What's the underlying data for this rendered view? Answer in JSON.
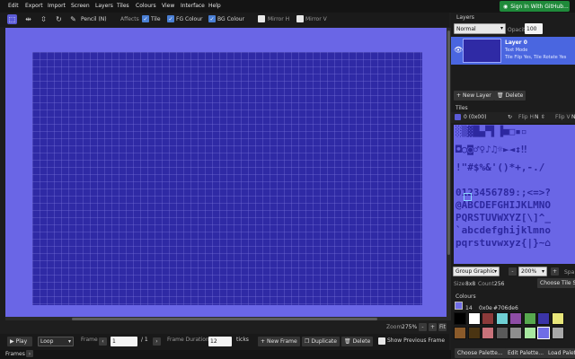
{
  "menubar": {
    "items": [
      "Edit",
      "Export",
      "Import",
      "Screen",
      "Layers",
      "Tiles",
      "Colours",
      "View",
      "Interface",
      "Help"
    ],
    "github_label": "Sign In With GitHub..."
  },
  "toolbar": {
    "tool_label": "Pencil (N)",
    "affects_label": "Affects",
    "tile_label": "Tile",
    "fg_label": "FG Colour",
    "bg_label": "BG Colour",
    "mirror_h_label": "Mirror H",
    "mirror_v_label": "Mirror V"
  },
  "canvas": {
    "zoom_label": "Zoom",
    "zoom_value": "275%",
    "zoom_minus": "-",
    "zoom_plus": "+",
    "fit_label": "Fit"
  },
  "animation": {
    "play_label": "Play",
    "loop_value": "Loop",
    "frame_label": "Frame",
    "frame_value": "1",
    "frame_total": "/ 1",
    "duration_label": "Frame Duration",
    "duration_value": "12",
    "ticks_label": "ticks",
    "new_frame_label": "New Frame",
    "duplicate_label": "Duplicate",
    "delete_label": "Delete",
    "show_prev_label": "Show Previous Frame",
    "frames_tab_label": "Frames"
  },
  "layers": {
    "title": "Layers",
    "blend_value": "Normal",
    "opacity_label": "Opacity",
    "opacity_value": "100",
    "layer_name": "Layer 0",
    "layer_mode": "Text Mode",
    "layer_flags": "Tile Flip Yes, Tile Rotate Yes",
    "new_layer_label": "New Layer",
    "delete_label": "Delete"
  },
  "tiles": {
    "title": "Tiles",
    "selected": "0 (0x00)",
    "flip_h_label": "Flip H",
    "flip_h_value": "N",
    "flip_v_label": "Flip V",
    "flip_v_value": "N",
    "group_value": "Group Graphic",
    "zoom_value": "200%",
    "spacing_label": "Spa",
    "size_label": "Size",
    "size_value": "8x8",
    "count_label": "Count",
    "count_value": "256",
    "choose_label": "Choose Tile Se",
    "glyph_rows": [
      "░▒▓█▄▀▌▐■□▪▫",
      "◘○◙♂♀♪♫☼►◄↕‼",
      "!\"#$%&'()*+,-./",
      "0123456789:;<=>?",
      "@ABCDEFGHIJKLMNO",
      "PQRSTUVWXYZ[\\]^_",
      "`abcdefghijklmno",
      "pqrstuvwxyz{|}~⌂"
    ]
  },
  "colours": {
    "title": "Colours",
    "index": "14",
    "hex_short": "0x0e",
    "hex_full": "#706de6",
    "swatches": [
      "#000000",
      "#ffffff",
      "#8c3a3a",
      "#6fd0d4",
      "#8e4da6",
      "#57a84e",
      "#3b34a8",
      "#e8e67a",
      "#8a5a2a",
      "#4a3412",
      "#c8727a",
      "#5a5a5a",
      "#8e8e8e",
      "#a8e8a0",
      "#706de6",
      "#a8a8a8"
    ],
    "choose_label": "Choose Palette...",
    "edit_label": "Edit Palette...",
    "load_label": "Load Palette..."
  }
}
